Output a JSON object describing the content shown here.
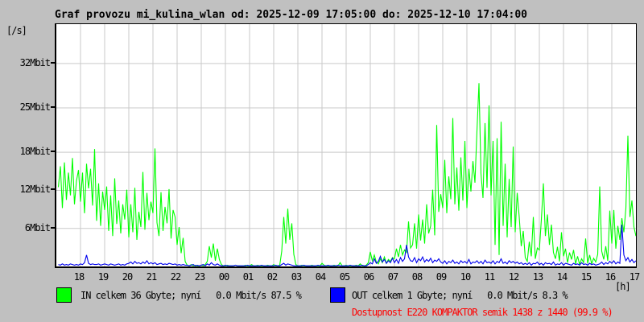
{
  "title": "Graf provozu mi_kulina_wlan od: 2025-12-09 17:05:00 do: 2025-12-10 17:04:00",
  "y_unit_label": "[/s]",
  "x_unit_label": "[h]",
  "legend": {
    "in": {
      "swatch_color": "#00FF00",
      "label": "IN celkem 36 Gbyte; nyní   0.0 Mbit/s 87.5 %"
    },
    "out": {
      "swatch_color": "#0000FF",
      "label": "OUT celkem 1 Gbyte; nyní   0.0 Mbit/s 8.3 %"
    }
  },
  "availability": {
    "text": "Dostupnost E220 KOMPAKTOR semik 1438 z 1440 (99.9 %)",
    "color": "#FF0000"
  },
  "colors": {
    "background": "#C0C0C0",
    "plot_background": "#FFFFFF",
    "grid": "#C9C9C9",
    "in_line": "#00FF00",
    "out_line": "#0000EE",
    "title_text": "#000000",
    "availability_text": "#FF0000"
  },
  "chart_data": {
    "type": "line",
    "title": "Graf provozu mi_kulina_wlan",
    "time_start": "2025-12-09 17:05:00",
    "time_end": "2025-12-10 17:04:00",
    "interval_minutes": 5,
    "ylabel": "[/s]",
    "ylim": [
      0,
      38.2
    ],
    "grid": true,
    "x_tick_labels": [
      "18",
      "19",
      "20",
      "21",
      "22",
      "23",
      "00",
      "01",
      "02",
      "03",
      "04",
      "05",
      "06",
      "07",
      "08",
      "09",
      "10",
      "11",
      "12",
      "13",
      "14",
      "15",
      "16",
      "17"
    ],
    "y_ticks": [
      {
        "label": "32Mbit",
        "value": 32
      },
      {
        "label": "25Mbit",
        "value": 25
      },
      {
        "label": "18Mbit",
        "value": 18
      },
      {
        "label": "12Mbit",
        "value": 12
      },
      {
        "label": "6Mbit",
        "value": 6
      }
    ],
    "series": [
      {
        "name": "IN",
        "unit": "Mbit/s",
        "color": "#00FF00",
        "values": [
          12.5,
          15.8,
          9.2,
          16.4,
          10.5,
          14.8,
          11.2,
          17.1,
          9.8,
          13.5,
          15.2,
          10.2,
          14.8,
          8.4,
          16.2,
          12.3,
          15.4,
          9.6,
          18.5,
          7.2,
          13.1,
          6.4,
          11.8,
          8.9,
          12.6,
          5.6,
          11.2,
          4.8,
          13.9,
          6.7,
          10.4,
          5.2,
          9.8,
          7.4,
          12.1,
          4.6,
          9.8,
          5.4,
          12.4,
          4.2,
          8.6,
          6.2,
          14.9,
          5.8,
          11.6,
          7.3,
          10.2,
          8.4,
          18.6,
          6.9,
          4.8,
          11.7,
          5.6,
          9.4,
          6.8,
          12.2,
          4.4,
          8.9,
          7.8,
          3.4,
          6.2,
          2.1,
          4.5,
          0.8,
          0.2,
          0.1,
          0.3,
          0.1,
          0.2,
          0.1,
          0.1,
          0.2,
          0.1,
          0.3,
          0.8,
          3.2,
          1.4,
          3.6,
          0.9,
          2.8,
          1.1,
          0.3,
          0.1,
          0.1,
          0.2,
          0.1,
          0.1,
          0.1,
          0.2,
          0.1,
          0.1,
          0.1,
          0.1,
          0.2,
          0.1,
          0.1,
          0.3,
          0.1,
          0.1,
          0.2,
          0.1,
          0.1,
          0.1,
          0.1,
          0.2,
          0.1,
          0.1,
          0.3,
          0.1,
          0.1,
          0.2,
          2.4,
          7.8,
          3.6,
          9.1,
          4.2,
          6.8,
          1.9,
          0.3,
          0.1,
          0.1,
          0.2,
          0.1,
          0.1,
          0.1,
          0.1,
          0.2,
          0.1,
          0.1,
          0.1,
          0.1,
          0.5,
          0.2,
          0.1,
          0.1,
          0.1,
          0.1,
          0.2,
          0.1,
          0.1,
          0.6,
          0.1,
          0.1,
          0.2,
          0.1,
          0.1,
          0.1,
          0.1,
          0.2,
          0.1,
          0.4,
          0.1,
          0.1,
          0.2,
          0.6,
          2.3,
          0.9,
          1.8,
          0.7,
          0.4,
          1.2,
          0.6,
          1.5,
          0.5,
          1.1,
          0.8,
          1.4,
          1.2,
          2.8,
          1.5,
          3.4,
          1.8,
          2.6,
          2.2,
          7.1,
          2.9,
          3.4,
          6.8,
          2.8,
          8.2,
          4.1,
          7.4,
          3.6,
          9.8,
          5.2,
          6.4,
          12.1,
          4.9,
          22.3,
          8.6,
          11.4,
          9.2,
          16.8,
          8.4,
          14.2,
          10.6,
          23.4,
          9.8,
          15.6,
          8.8,
          17.2,
          10.4,
          19.8,
          9.2,
          15.4,
          11.8,
          16.6,
          13.2,
          21.4,
          28.9,
          14.6,
          10.8,
          22.6,
          12.4,
          25.4,
          11.2,
          19.8,
          3.4,
          20.2,
          1.8,
          22.8,
          6.4,
          16.2,
          4.6,
          13.8,
          6.2,
          18.9,
          5.4,
          11.6,
          7.8,
          3.2,
          5.6,
          1.4,
          0.8,
          3.9,
          1.6,
          7.8,
          1.2,
          2.9,
          2.6,
          7.4,
          13.1,
          4.8,
          8.2,
          3.4,
          6.6,
          2.2,
          1.2,
          3.1,
          0.8,
          5.4,
          1.6,
          2.8,
          0.6,
          2.2,
          1.1,
          2.6,
          0.4,
          1.6,
          0.3,
          1.2,
          0.6,
          4.4,
          0.5,
          1.8,
          0.4,
          1.3,
          0.7,
          1.9,
          12.6,
          2.4,
          1.1,
          3.2,
          0.9,
          8.8,
          3.6,
          8.9,
          2.8,
          6.4,
          4.2,
          7.6,
          5.4,
          9.2,
          20.6,
          7.8,
          10.4,
          6.2,
          4.8
        ]
      },
      {
        "name": "OUT",
        "unit": "Mbit/s",
        "color": "#0000EE",
        "values": [
          0.3,
          0.2,
          0.4,
          0.2,
          0.3,
          0.2,
          0.4,
          0.3,
          0.2,
          0.3,
          0.2,
          0.4,
          0.3,
          0.6,
          1.8,
          0.5,
          0.3,
          0.4,
          0.3,
          0.3,
          0.4,
          0.2,
          0.3,
          0.4,
          0.3,
          0.2,
          0.4,
          0.3,
          0.2,
          0.3,
          0.4,
          0.2,
          0.3,
          0.2,
          0.4,
          0.5,
          0.7,
          0.4,
          0.8,
          0.5,
          0.6,
          0.4,
          0.7,
          0.5,
          0.9,
          0.4,
          0.6,
          0.4,
          0.6,
          0.3,
          0.4,
          0.5,
          0.3,
          0.4,
          0.3,
          0.5,
          0.4,
          0.3,
          0.4,
          0.2,
          0.3,
          0.2,
          0.3,
          0.2,
          0.2,
          0.1,
          0.2,
          0.3,
          0.1,
          0.2,
          0.1,
          0.2,
          0.3,
          0.1,
          0.4,
          0.2,
          0.6,
          0.3,
          0.2,
          0.4,
          0.2,
          0.1,
          0.1,
          0.2,
          0.1,
          0.1,
          0.1,
          0.1,
          0.2,
          0.1,
          0.1,
          0.1,
          0.1,
          0.1,
          0.2,
          0.1,
          0.1,
          0.1,
          0.1,
          0.1,
          0.1,
          0.2,
          0.1,
          0.1,
          0.1,
          0.1,
          0.1,
          0.1,
          0.2,
          0.1,
          0.1,
          0.3,
          0.5,
          0.2,
          0.4,
          0.3,
          0.2,
          0.1,
          0.1,
          0.1,
          0.1,
          0.1,
          0.2,
          0.1,
          0.1,
          0.1,
          0.1,
          0.1,
          0.1,
          0.2,
          0.1,
          0.1,
          0.1,
          0.1,
          0.2,
          0.1,
          0.1,
          0.1,
          0.1,
          0.2,
          0.1,
          0.1,
          0.1,
          0.1,
          0.1,
          0.2,
          0.1,
          0.1,
          0.1,
          0.1,
          0.1,
          0.2,
          0.1,
          0.1,
          0.3,
          0.6,
          0.4,
          1.2,
          0.5,
          0.8,
          1.6,
          0.7,
          1.1,
          0.5,
          0.9,
          0.6,
          1.3,
          0.6,
          1.1,
          0.5,
          1.4,
          0.8,
          1.2,
          3.4,
          1.5,
          0.9,
          0.8,
          1.4,
          0.6,
          1.2,
          0.9,
          1.5,
          0.7,
          1.1,
          0.8,
          1.3,
          0.6,
          1.0,
          0.8,
          1.2,
          0.7,
          0.5,
          0.9,
          0.4,
          0.8,
          0.6,
          1.0,
          0.5,
          0.7,
          0.4,
          0.9,
          0.6,
          0.8,
          0.5,
          1.1,
          0.4,
          0.7,
          0.6,
          0.9,
          0.5,
          0.8,
          0.4,
          1.0,
          0.6,
          0.7,
          0.5,
          0.9,
          0.4,
          0.8,
          0.6,
          1.2,
          0.5,
          0.7,
          0.4,
          0.9,
          0.6,
          0.8,
          0.5,
          0.7,
          0.4,
          0.6,
          0.3,
          0.5,
          0.3,
          0.6,
          0.2,
          0.5,
          0.4,
          0.7,
          0.3,
          0.5,
          0.2,
          0.6,
          0.4,
          0.5,
          0.3,
          0.7,
          0.2,
          0.4,
          0.3,
          0.6,
          0.2,
          0.5,
          0.4,
          0.3,
          0.2,
          0.5,
          0.3,
          0.4,
          0.2,
          0.6,
          0.3,
          0.4,
          0.2,
          0.5,
          0.3,
          0.4,
          0.2,
          0.3,
          0.4,
          0.7,
          0.3,
          0.6,
          0.4,
          0.8,
          0.5,
          0.9,
          0.4,
          0.7,
          0.5,
          6.6,
          1.8,
          0.9,
          1.4,
          0.7,
          1.1,
          0.6,
          0.9
        ]
      }
    ],
    "legend_position": "bottom"
  }
}
